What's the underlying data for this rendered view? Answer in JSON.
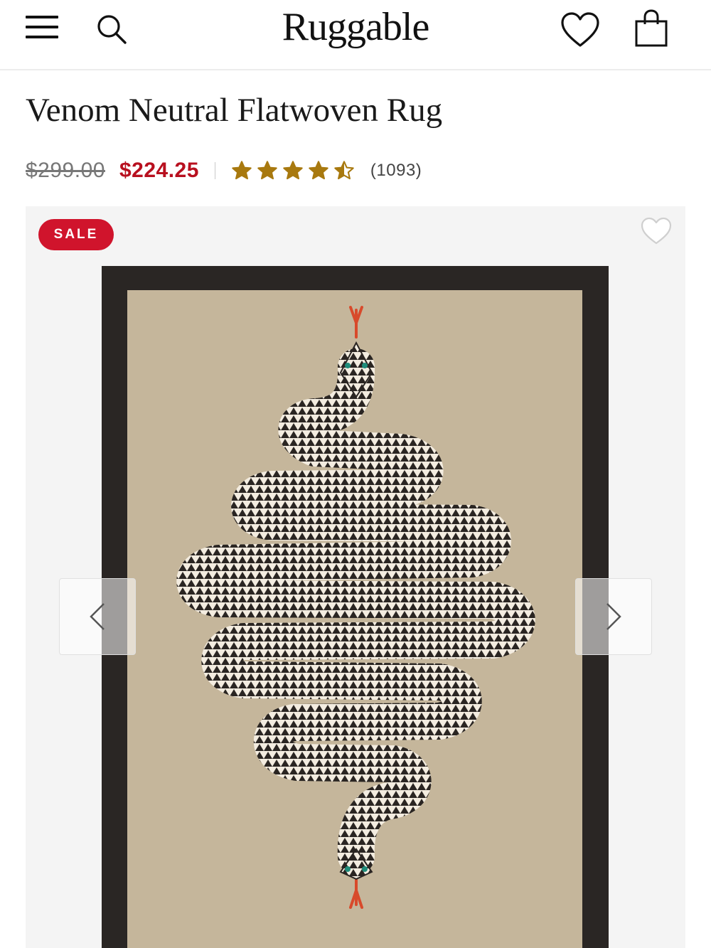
{
  "header": {
    "menu_icon": "hamburger-menu-icon",
    "search_icon": "search-icon",
    "logo_text": "Ruggable",
    "wishlist_icon": "heart-icon",
    "cart_icon": "shopping-bag-icon"
  },
  "product": {
    "title": "Venom Neutral Flatwoven Rug",
    "original_price": "$299.00",
    "sale_price": "$224.25",
    "rating": 4.5,
    "rating_max": 5,
    "review_count": "(1093)"
  },
  "gallery": {
    "badge": "SALE",
    "favorite_icon": "heart-outline-icon",
    "prev_icon": "chevron-left-icon",
    "next_icon": "chevron-right-icon"
  },
  "colors": {
    "sale_red": "#d0142c",
    "price_red": "#b8101f",
    "star_gold": "#a8790f",
    "rug_border": "#2a2624",
    "rug_field": "#c5b69b"
  }
}
